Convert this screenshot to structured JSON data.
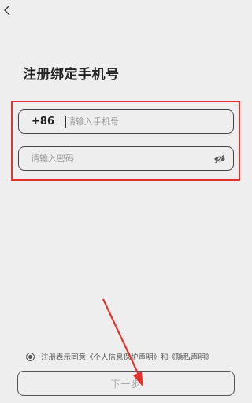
{
  "header": {
    "back_icon": "chevron-left-icon"
  },
  "page": {
    "title": "注册绑定手机号"
  },
  "phone": {
    "country_code": "+86",
    "value": "",
    "placeholder": "请输入手机号"
  },
  "password": {
    "value": "",
    "placeholder": "请输入密码",
    "visibility_icon": "eye-off-icon"
  },
  "agreement": {
    "prefix": "注册表示同意",
    "privacy_protect": "《个人信息保护声明》",
    "and": "和",
    "privacy": "《隐私声明》",
    "checked": false
  },
  "next_button": {
    "label": "下一步"
  },
  "colors": {
    "background": "#eeeeee",
    "annotation": "#e5322d"
  }
}
